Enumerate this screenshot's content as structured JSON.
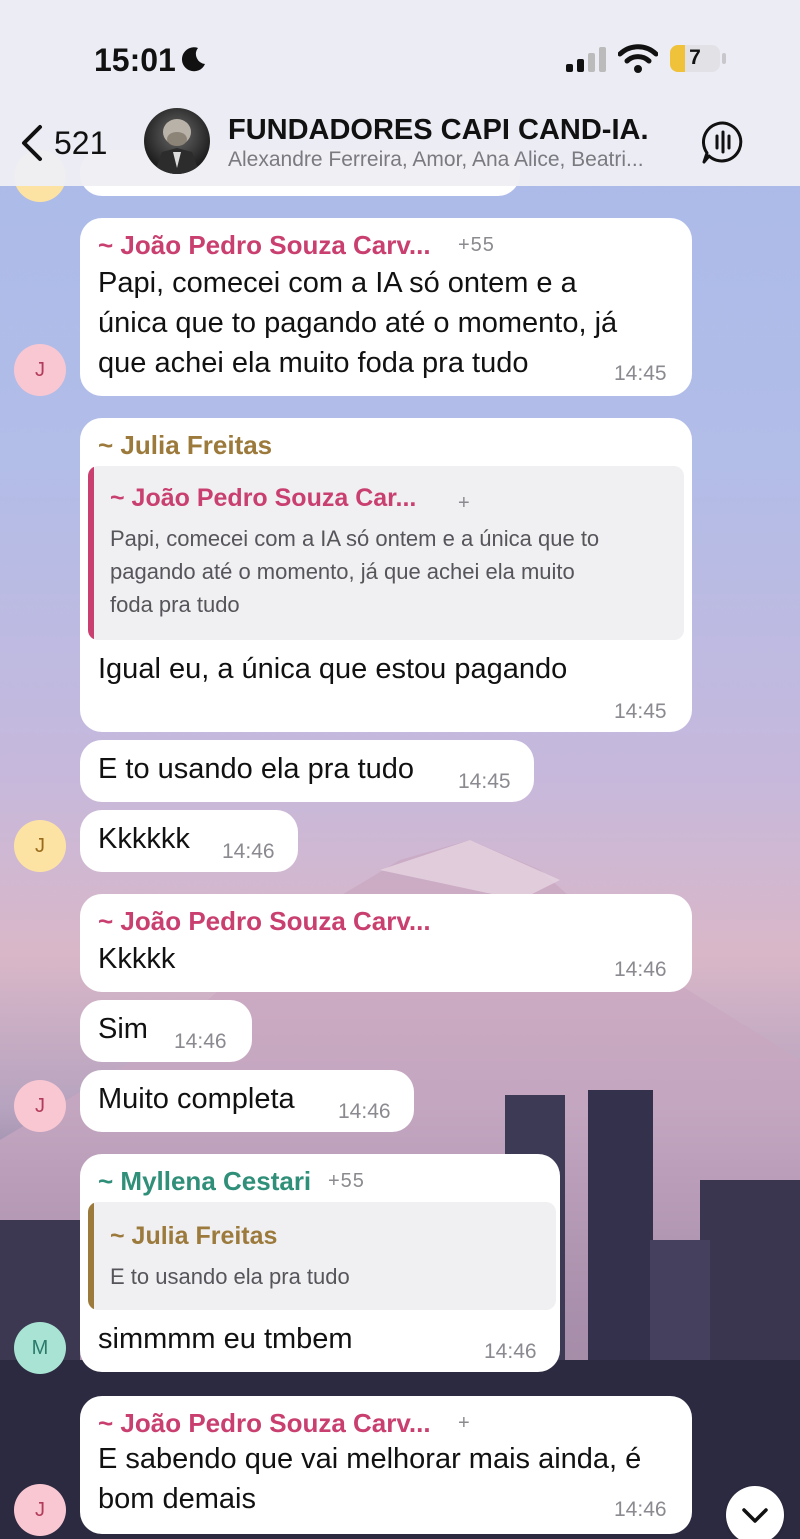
{
  "status_bar": {
    "time": "15:01",
    "battery": "7"
  },
  "nav": {
    "back_count": "521",
    "title": "FUNDADORES CAPI CAND-IA.",
    "subtitle": "Alexandre Ferreira, Amor, Ana Alice, Beatri..."
  },
  "messages": [
    {
      "sender": "~ João Pedro Souza Carv...",
      "phone": "+55",
      "lines": [
        "Papi, comecei com a IA só ontem e a",
        "única que to pagando até o momento, já",
        "que achei ela muito foda pra tudo"
      ],
      "time": "14:45",
      "avatar": "J"
    },
    {
      "sender": "~ Julia Freitas",
      "reply": {
        "sender": "~ João Pedro Souza Car...",
        "phone": "+",
        "lines": [
          "Papi, comecei com a IA só ontem e a única que to",
          "pagando até o momento, já que achei ela muito",
          "foda pra tudo"
        ]
      },
      "text": "Igual eu, a única que estou pagando",
      "time": "14:45"
    },
    {
      "text": "E to usando ela pra tudo",
      "time": "14:45"
    },
    {
      "text": "Kkkkkk",
      "time": "14:46",
      "avatar": "J"
    },
    {
      "sender": "~ João Pedro Souza Carv...",
      "text": "Kkkkk",
      "time": "14:46"
    },
    {
      "text": "Sim",
      "time": "14:46"
    },
    {
      "text": "Muito completa",
      "time": "14:46",
      "avatar": "J"
    },
    {
      "sender": "~ Myllena Cestari",
      "phone": "+55",
      "reply": {
        "sender": "~ Julia Freitas",
        "text": "E to usando ela pra tudo"
      },
      "text": "simmmm eu tmbem",
      "time": "14:46",
      "avatar": "M"
    },
    {
      "sender": "~ João Pedro Souza Carv...",
      "phone": "+",
      "lines": [
        "E sabendo que vai melhorar mais ainda, é",
        "bom demais"
      ],
      "time": "14:46",
      "avatar": "J"
    }
  ],
  "colors": {
    "pink": "#c93f6f",
    "gold": "#9c7a3c",
    "teal": "#2f8f79"
  }
}
